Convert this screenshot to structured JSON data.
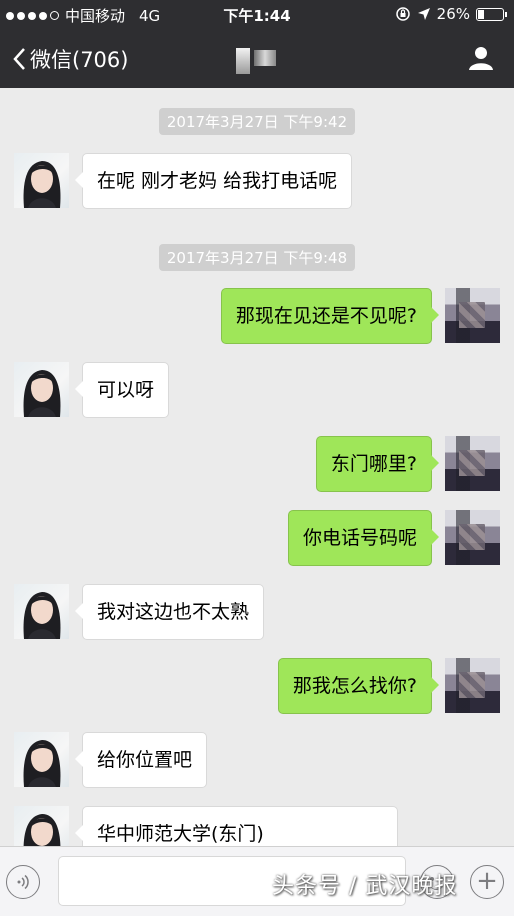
{
  "status_bar": {
    "carrier": "中国移动",
    "network": "4G",
    "time": "下午1:44",
    "battery_percent": "26%",
    "battery_level": 0.26
  },
  "nav": {
    "back_label": "微信(706)"
  },
  "messages": [
    {
      "type": "time",
      "text": "2017年3月27日 下午9:42"
    },
    {
      "type": "in",
      "text": "在呢  刚才老妈  给我打电话呢"
    },
    {
      "type": "time",
      "text": "2017年3月27日 下午9:48"
    },
    {
      "type": "out",
      "text": "那现在见还是不见呢?"
    },
    {
      "type": "in",
      "text": "可以呀"
    },
    {
      "type": "out",
      "text": "东门哪里?"
    },
    {
      "type": "out",
      "text": "你电话号码呢"
    },
    {
      "type": "in",
      "text": "我对这边也不太熟"
    },
    {
      "type": "out",
      "text": "那我怎么找你?"
    },
    {
      "type": "in",
      "text": "给你位置吧"
    },
    {
      "type": "in",
      "text": "华中师范大学(东门)"
    }
  ],
  "watermark": "头条号 / 武汉晚报",
  "colors": {
    "header_bg": "#2e2e31",
    "chat_bg": "#ebebeb",
    "outgoing_bubble": "#9fe659",
    "incoming_bubble": "#ffffff"
  }
}
